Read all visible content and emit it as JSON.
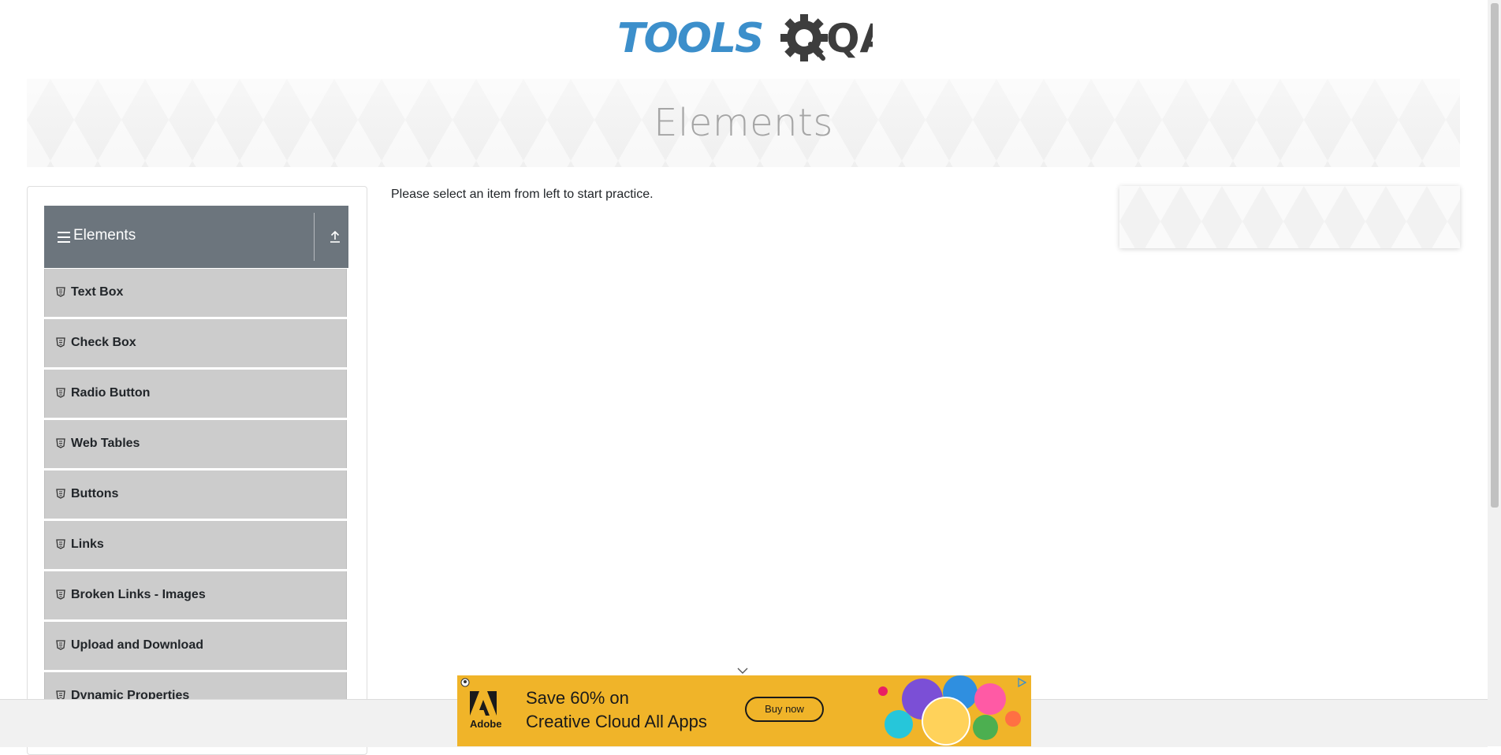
{
  "header": {
    "logo_text_tools": "TOOLS",
    "logo_text_qa": "QA"
  },
  "banner": {
    "title": "Elements"
  },
  "sidebar": {
    "group_title": "Elements",
    "items": [
      {
        "label": "Text Box"
      },
      {
        "label": "Check Box"
      },
      {
        "label": "Radio Button"
      },
      {
        "label": "Web Tables"
      },
      {
        "label": "Buttons"
      },
      {
        "label": "Links"
      },
      {
        "label": "Broken Links - Images"
      },
      {
        "label": "Upload and Download"
      },
      {
        "label": "Dynamic Properties"
      }
    ]
  },
  "main": {
    "instruction": "Please select an item from left to start practice."
  },
  "ad": {
    "brand": "Adobe",
    "line1": "Save 60% on",
    "line2": "Creative Cloud All Apps",
    "cta": "Buy now"
  },
  "colors": {
    "logo_blue": "#3c8fcb",
    "logo_dark": "#3d3d3d",
    "group_header": "#6c757d",
    "menu_item": "#cccccc",
    "ad_background": "#f0b429"
  },
  "icons": {
    "group_header": "menu-lines-icon",
    "group_toggle": "collapse-up-icon",
    "menu_item": "shield-icon"
  }
}
